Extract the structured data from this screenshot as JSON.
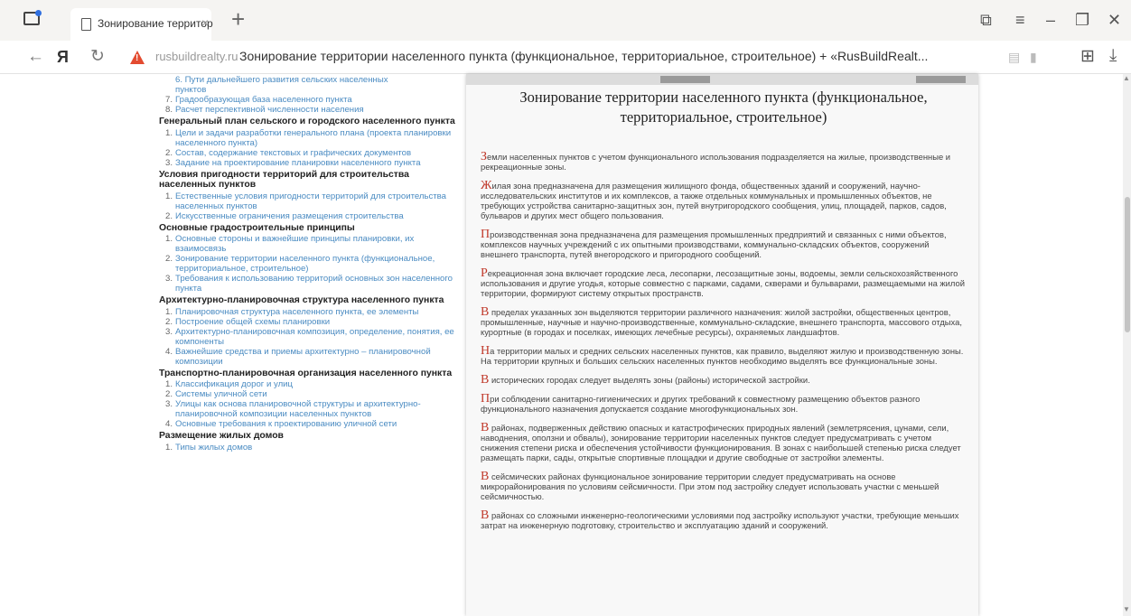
{
  "browser": {
    "tab_title": "Зонирование территор",
    "domain": "rusbuildrealty.ru",
    "page_title_in_address": "Зонирование территории населенного пункта (функциональное, территориальное, строительное) + «RusBuildRealt...",
    "yandex_logo": "Я"
  },
  "sidebar": {
    "sections": [
      {
        "title": "",
        "items": [
          {
            "n": "",
            "text": "6. Пути дальнейшего развития сельских населенных"
          },
          {
            "n": "",
            "text": "пунктов"
          },
          {
            "n": "7.",
            "text": "Градообразующая база населенного пункта"
          },
          {
            "n": "8.",
            "text": "Расчет перспективной численности населения"
          }
        ]
      },
      {
        "title": "Генеральный план сельского и городского населенного пункта",
        "items": [
          {
            "n": "1.",
            "text": "Цели и задачи разработки генерального плана (проекта планировки населенного пункта)"
          },
          {
            "n": "2.",
            "text": "Состав, содержание текстовых и графических документов"
          },
          {
            "n": "3.",
            "text": "Задание на проектирование планировки населенного пункта"
          }
        ]
      },
      {
        "title": "Условия пригодности территорий для строительства населенных пунктов",
        "items": [
          {
            "n": "1.",
            "text": "Естественные условия пригодности территорий для строительства населенных пунктов"
          },
          {
            "n": "2.",
            "text": "Искусственные ограничения размещения строительства"
          }
        ]
      },
      {
        "title": "Основные градостроительные принципы",
        "items": [
          {
            "n": "1.",
            "text": "Основные стороны и важнейшие принципы планировки, их взаимосвязь"
          },
          {
            "n": "2.",
            "text": "Зонирование территории населенного пункта (функциональное, территориальное, строительное)"
          },
          {
            "n": "3.",
            "text": "Требования к использованию территорий основных зон населенного пункта"
          }
        ]
      },
      {
        "title": "Архитектурно-планировочная структура населенного пункта",
        "items": [
          {
            "n": "1.",
            "text": "Планировочная структура населенного пункта, ее элементы"
          },
          {
            "n": "2.",
            "text": "Построение общей схемы планировки"
          },
          {
            "n": "3.",
            "text": "Архитектурно-планировочная композиция, определение, понятия, ее компоненты"
          },
          {
            "n": "4.",
            "text": "Важнейшие средства и приемы архитектурно – планировочной композиции"
          }
        ]
      },
      {
        "title": "Транспортно-планировочная организация населенного пункта",
        "items": [
          {
            "n": "1.",
            "text": "Классификация дорог и улиц"
          },
          {
            "n": "2.",
            "text": "Системы уличной сети"
          },
          {
            "n": "3.",
            "text": "Улицы как основа планировочной структуры и архитектурно-планировочной композиции населенных пунктов"
          },
          {
            "n": "4.",
            "text": "Основные требования к проектированию уличной сети"
          }
        ]
      },
      {
        "title": "Размещение жилых домов",
        "items": [
          {
            "n": "1.",
            "text": "Типы жилых домов"
          }
        ]
      }
    ]
  },
  "article": {
    "title": "Зонирование территории населенного пункта (функциональное, территориальное, строительное)",
    "paragraphs": [
      {
        "cap": "З",
        "text": "емли населенных пунктов с учетом функционального использования подразделяется на жилые, производственные и рекреационные зоны."
      },
      {
        "cap": "Ж",
        "text": "илая зона предназначена для размещения жилищного фонда, общественных зданий и сооружений, научно-исследовательских институтов и их комплексов, а также отдельных коммунальных и промышленных объектов, не требующих устройства санитарно-защитных зон, путей внутригородского сообщения, улиц, площадей, парков, садов, бульваров и других мест общего пользования."
      },
      {
        "cap": "П",
        "text": "роизводственная зона предназначена для размещения промышленных предприятий и связанных с ними объектов, комплексов научных учреждений с их опытными производствами, коммунально-складских объектов, сооружений внешнего транспорта, путей внегородского и пригородного сообщений."
      },
      {
        "cap": "Р",
        "text": "екреационная зона включает городские леса, лесопарки, лесозащитные зоны, водоемы, земли сельскохозяйственного использования и другие угодья, которые совместно с парками, садами, скверами и бульварами, размещаемыми на жилой территории, формируют систему открытых пространств."
      },
      {
        "cap": "В",
        "text": " пределах указанных зон выделяются территории различного назначения: жилой застройки, общественных центров, промышленные, научные и научно-производственные, коммунально-складские, внешнего транспорта, массового отдыха, курортные (в городах и поселках, имеющих лечебные ресурсы), охраняемых ландшафтов."
      },
      {
        "cap": "Н",
        "text": "а территории малых и средних сельских населенных пунктов, как правило, выделяют жилую и производственную зоны. На территории крупных и больших сельских населенных пунктов необходимо выделять все функциональные зоны."
      },
      {
        "cap": "В",
        "text": " исторических городах следует выделять зоны (районы) исторической застройки."
      },
      {
        "cap": "П",
        "text": "ри соблюдении санитарно-гигиенических и других требований к совместному размещению объектов разного функционального назначения допускается создание многофункциональных зон."
      },
      {
        "cap": "В",
        "text": " районах, подверженных действию опасных и катастрофических природных явлений (землетрясения, цунами, сели, наводнения, оползни и обвалы), зонирование территории населенных пунктов следует предусматривать с учетом снижения степени риска и обеспечения устойчивости функционирования. В зонах с наибольшей степенью риска следует размещать парки, сады, открытые спортивные площадки и другие свободные от застройки элементы."
      },
      {
        "cap": "В",
        "text": " сейсмических районах функциональное зонирование территории следует предусматривать на основе микрорайонирования по условиям сейсмичности. При этом под застройку следует использовать участки с меньшей сейсмичностью."
      },
      {
        "cap": "В",
        "text": " районах со сложными инженерно-геологическими условиями под застройку используют участки, требующие меньших затрат на инженерную подготовку, строительство и эксплуатацию зданий и сооружений."
      }
    ]
  },
  "colors": {
    "link": "#4a8bc2",
    "dropcap": "#c0392b",
    "warning": "#e34b30"
  }
}
